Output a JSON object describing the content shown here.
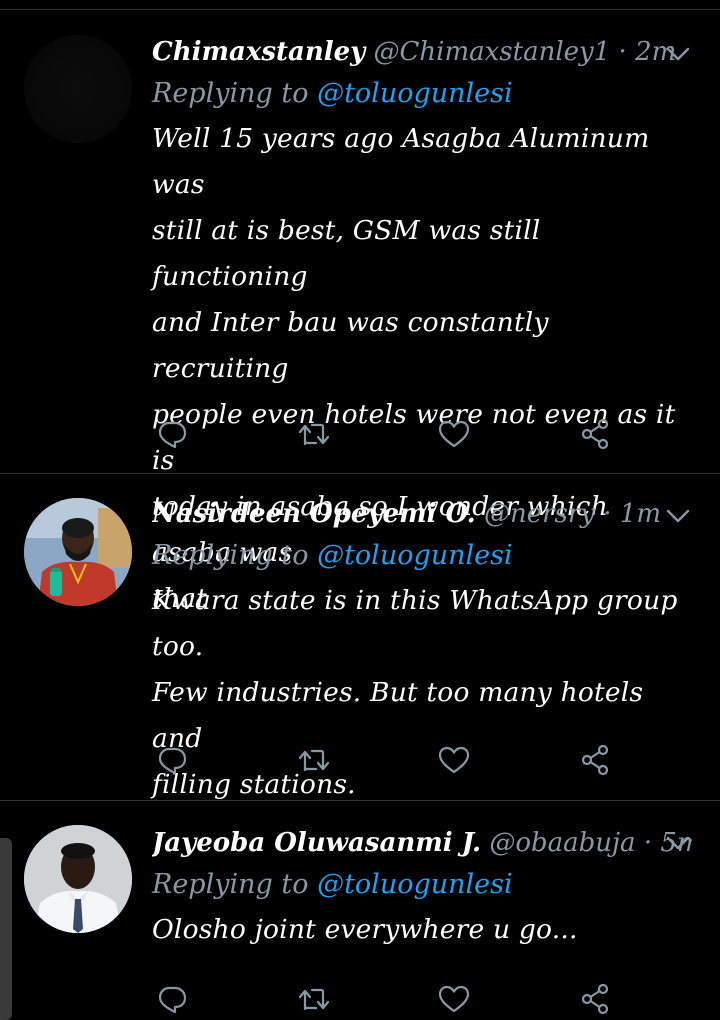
{
  "tweets": [
    {
      "name": "Chimaxstanley",
      "handle": "@Chimaxstanley1",
      "separator": "·",
      "time": "2m",
      "reply_prefix": "Replying to",
      "reply_to": "@toluogunlesi",
      "lines": [
        "Well 15 years ago Asagba Aluminum was",
        "still at is best, GSM was still functioning",
        "and Inter bau was constantly recruiting",
        "people even hotels were not even as it is",
        "today in asaba so I wonder which asaba was",
        "that"
      ],
      "avatar": "dark-placeholder"
    },
    {
      "name": "Nasirdeen Opeyemi O.",
      "handle": "@nersry",
      "separator": "·",
      "time": "1m",
      "reply_prefix": "Replying to",
      "reply_to": "@toluogunlesi",
      "lines": [
        "Kwara state is in this WhatsApp group too.",
        "Few industries. But too many hotels and",
        "filling stations."
      ],
      "avatar": "man-red-shirt"
    },
    {
      "name": "Jayeoba Oluwasanmi J.",
      "handle": "@obaabuja",
      "separator": "·",
      "time": "5m",
      "reply_prefix": "Replying to",
      "reply_to": "@toluogunlesi",
      "lines": [
        "Olosho joint everywhere u go..."
      ],
      "avatar": "man-white-shirt-tie"
    }
  ],
  "icons": {
    "reply": "reply-icon",
    "retweet": "retweet-icon",
    "like": "like-icon",
    "share": "share-icon",
    "more": "chevron-down-icon"
  },
  "colors": {
    "background": "#000000",
    "accent": "#1da1f2",
    "muted": "#8899a6",
    "divider": "#2f3336"
  }
}
